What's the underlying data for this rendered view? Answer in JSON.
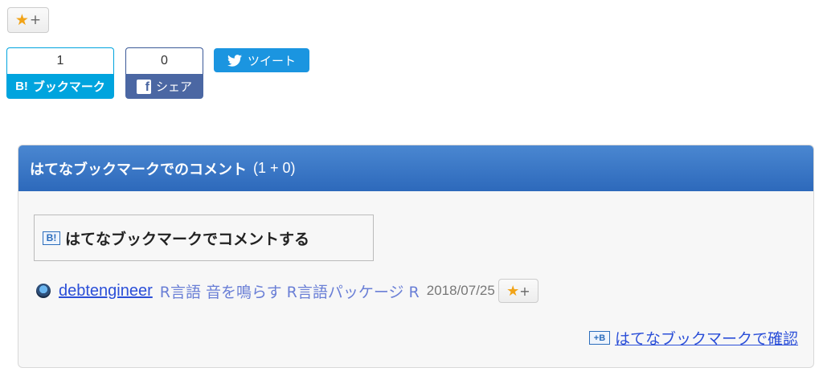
{
  "top_star": {
    "star": "★",
    "plus": "+"
  },
  "share": {
    "hatena": {
      "count": "1",
      "mark": "B!",
      "label": "ブックマーク"
    },
    "facebook": {
      "count": "0",
      "icon": "f",
      "label": "シェア"
    },
    "twitter": {
      "label": "ツイート"
    }
  },
  "comments": {
    "title": "はてなブックマークでのコメント",
    "count": "(1 + 0)",
    "comment_button": {
      "icon": "B!",
      "label": "はてなブックマークでコメントする"
    },
    "bookmarks": [
      {
        "user": "debtengineer",
        "tags": "R言語 音を鳴らす R言語パッケージ R",
        "date": "2018/07/25",
        "star": "★",
        "plus": "+"
      }
    ],
    "confirm": {
      "icon": "+B",
      "label": "はてなブックマークで確認"
    }
  },
  "colors": {
    "hatena_blue": "#00a4de",
    "facebook_blue": "#4b67a3",
    "twitter_blue": "#1b95e0",
    "header_blue": "#2d69bb",
    "star_yellow": "#f1a317",
    "link_blue": "#2b4fd8"
  },
  "icons": [
    "star-icon",
    "plus-icon",
    "hatena-bookmark-icon",
    "facebook-icon",
    "twitter-bird-icon",
    "user-avatar-icon"
  ]
}
